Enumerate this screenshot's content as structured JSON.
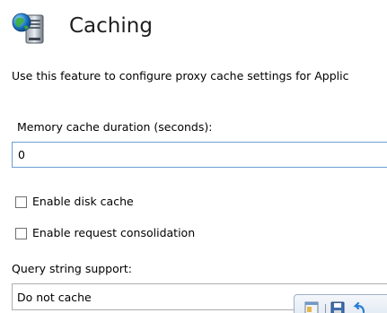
{
  "header": {
    "title": "Caching",
    "icon": "server-globe-icon"
  },
  "description": "Use this feature to configure proxy cache settings for Applic",
  "memory_cache": {
    "label": "Memory cache duration (seconds):",
    "value": "0"
  },
  "checkboxes": [
    {
      "label": "Enable disk cache",
      "checked": false
    },
    {
      "label": "Enable request consolidation",
      "checked": false
    }
  ],
  "query_string": {
    "label": "Query string support:",
    "selected": "Do not cache"
  },
  "colors": {
    "input_focus_border": "#6d9fd5",
    "checkbox_border": "#707070"
  }
}
